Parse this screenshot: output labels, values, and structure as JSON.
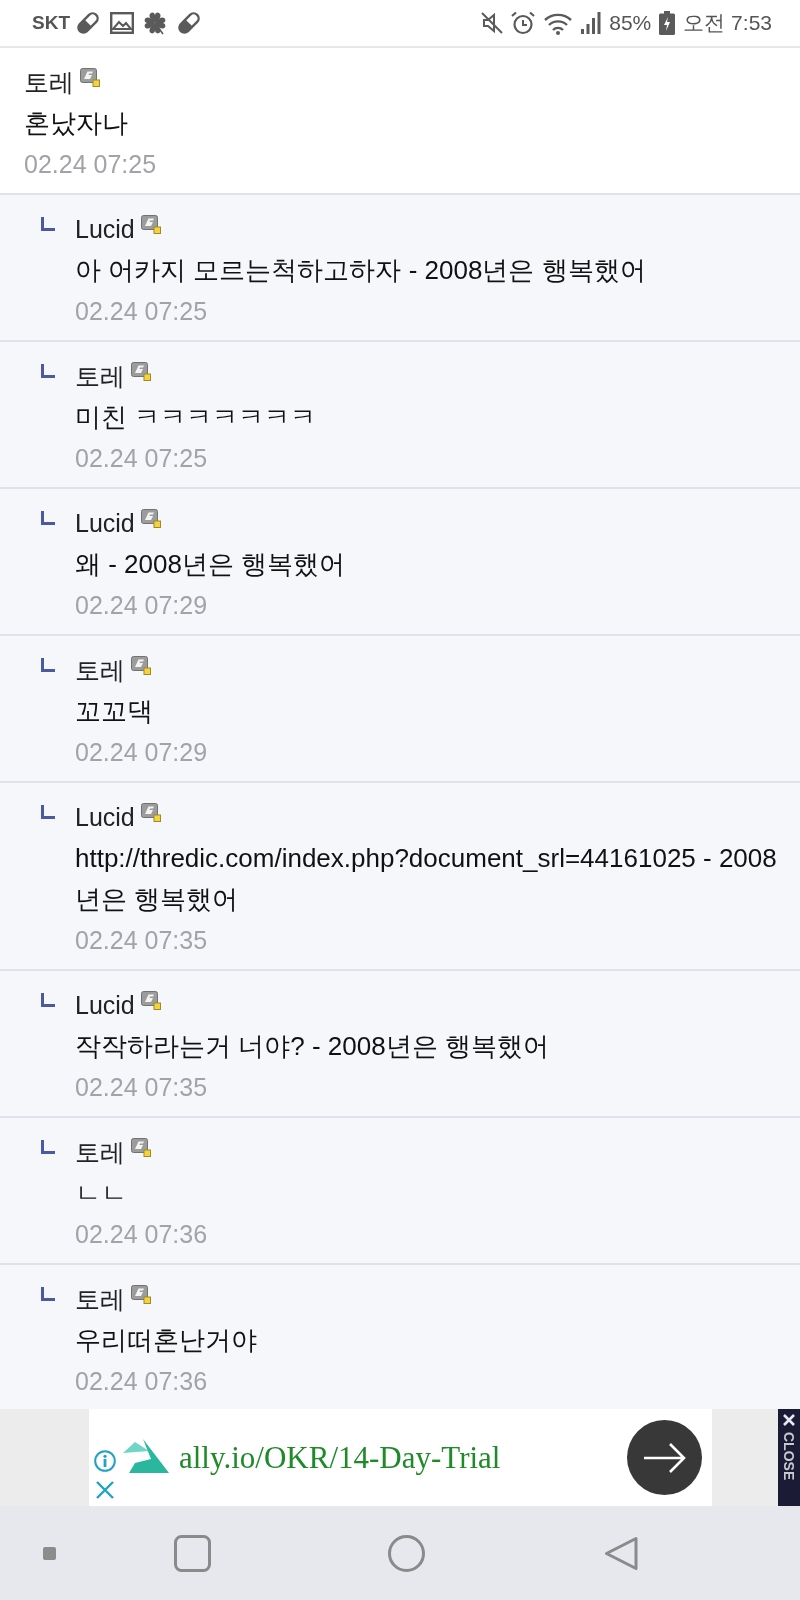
{
  "status_bar": {
    "carrier": "SKT",
    "battery": "85%",
    "clock": "오전 7:53"
  },
  "comments": [
    {
      "kind": "comment",
      "author": "토레",
      "body": "혼났자나",
      "date": "02.24 07:25"
    },
    {
      "kind": "reply",
      "author": "Lucid",
      "body": "아 어카지 모르는척하고하자 - 2008년은 행복했어",
      "date": "02.24 07:25"
    },
    {
      "kind": "reply",
      "author": "토레",
      "body": "미친 ㅋㅋㅋㅋㅋㅋㅋ",
      "date": "02.24 07:25"
    },
    {
      "kind": "reply",
      "author": "Lucid",
      "body": "왜 - 2008년은 행복했어",
      "date": "02.24 07:29"
    },
    {
      "kind": "reply",
      "author": "토레",
      "body": "꼬꼬댁",
      "date": "02.24 07:29"
    },
    {
      "kind": "reply",
      "author": "Lucid",
      "body": "http://thredic.com/index.php?document_srl=44161025 - 2008년은 행복했어",
      "date": "02.24 07:35"
    },
    {
      "kind": "reply",
      "author": "Lucid",
      "body": "작작하라는거 너야? - 2008년은 행복했어",
      "date": "02.24 07:35"
    },
    {
      "kind": "reply",
      "author": "토레",
      "body": "ㄴㄴ",
      "date": "02.24 07:36"
    },
    {
      "kind": "reply",
      "author": "토레",
      "body": "우리떠혼난거야",
      "date": "02.24 07:36"
    }
  ],
  "ad": {
    "link": "ally.io/OKR/14-Day-Trial",
    "close_label": "CLOSE"
  }
}
